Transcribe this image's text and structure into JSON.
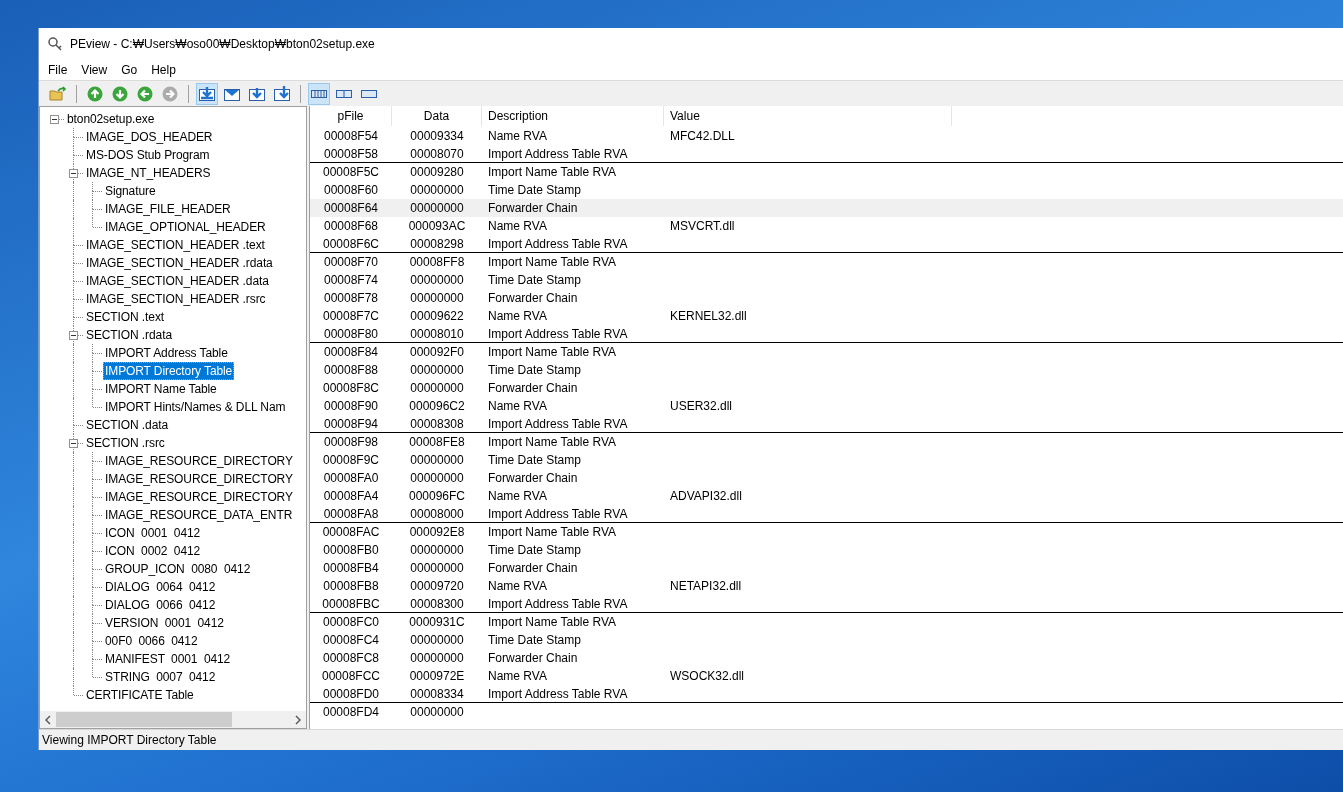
{
  "window": {
    "title": "PEview - C:₩Users₩oso00₩Desktop₩bton02setup.exe"
  },
  "menu": [
    {
      "label": "File"
    },
    {
      "label": "View"
    },
    {
      "label": "Go"
    },
    {
      "label": "Help"
    }
  ],
  "toolbar": {
    "groups": [
      {
        "buttons": [
          {
            "kind": "open",
            "pressed": false,
            "disabled": false
          }
        ]
      },
      {
        "buttons": [
          {
            "kind": "up",
            "pressed": false,
            "disabled": false
          },
          {
            "kind": "down",
            "pressed": false,
            "disabled": false
          },
          {
            "kind": "back",
            "pressed": false,
            "disabled": false
          },
          {
            "kind": "forward",
            "pressed": false,
            "disabled": true
          }
        ]
      },
      {
        "buttons": [
          {
            "kind": "view-hex",
            "pressed": true,
            "disabled": false
          },
          {
            "kind": "view-box",
            "pressed": false,
            "disabled": false
          },
          {
            "kind": "view-down",
            "pressed": false,
            "disabled": false
          },
          {
            "kind": "view-deep",
            "pressed": false,
            "disabled": false
          }
        ]
      },
      {
        "buttons": [
          {
            "kind": "layout-wide",
            "pressed": true,
            "disabled": false
          },
          {
            "kind": "layout-split",
            "pressed": false,
            "disabled": false
          },
          {
            "kind": "layout-single",
            "pressed": false,
            "disabled": false
          }
        ]
      }
    ]
  },
  "tree": [
    {
      "label": "bton02setup.exe",
      "selected": false,
      "expanded": true,
      "children": [
        {
          "label": "IMAGE_DOS_HEADER",
          "selected": false
        },
        {
          "label": "MS-DOS Stub Program",
          "selected": false
        },
        {
          "label": "IMAGE_NT_HEADERS",
          "selected": false,
          "expanded": true,
          "children": [
            {
              "label": "Signature",
              "selected": false
            },
            {
              "label": "IMAGE_FILE_HEADER",
              "selected": false
            },
            {
              "label": "IMAGE_OPTIONAL_HEADER",
              "selected": false
            }
          ]
        },
        {
          "label": "IMAGE_SECTION_HEADER .text",
          "selected": false
        },
        {
          "label": "IMAGE_SECTION_HEADER .rdata",
          "selected": false
        },
        {
          "label": "IMAGE_SECTION_HEADER .data",
          "selected": false
        },
        {
          "label": "IMAGE_SECTION_HEADER .rsrc",
          "selected": false
        },
        {
          "label": "SECTION .text",
          "selected": false
        },
        {
          "label": "SECTION .rdata",
          "selected": false,
          "expanded": true,
          "children": [
            {
              "label": "IMPORT Address Table",
              "selected": false
            },
            {
              "label": "IMPORT Directory Table",
              "selected": true
            },
            {
              "label": "IMPORT Name Table",
              "selected": false
            },
            {
              "label": "IMPORT Hints/Names & DLL Nam",
              "selected": false
            }
          ]
        },
        {
          "label": "SECTION .data",
          "selected": false
        },
        {
          "label": "SECTION .rsrc",
          "selected": false,
          "expanded": true,
          "children": [
            {
              "label": "IMAGE_RESOURCE_DIRECTORY",
              "selected": false
            },
            {
              "label": "IMAGE_RESOURCE_DIRECTORY",
              "selected": false
            },
            {
              "label": "IMAGE_RESOURCE_DIRECTORY",
              "selected": false
            },
            {
              "label": "IMAGE_RESOURCE_DATA_ENTR",
              "selected": false
            },
            {
              "label": "ICON  0001  0412",
              "selected": false
            },
            {
              "label": "ICON  0002  0412",
              "selected": false
            },
            {
              "label": "GROUP_ICON  0080  0412",
              "selected": false
            },
            {
              "label": "DIALOG  0064  0412",
              "selected": false
            },
            {
              "label": "DIALOG  0066  0412",
              "selected": false
            },
            {
              "label": "VERSION  0001  0412",
              "selected": false
            },
            {
              "label": "00F0  0066  0412",
              "selected": false
            },
            {
              "label": "MANIFEST  0001  0412",
              "selected": false
            },
            {
              "label": "STRING  0007  0412",
              "selected": false
            }
          ]
        },
        {
          "label": "CERTIFICATE Table",
          "selected": false
        }
      ]
    }
  ],
  "table": {
    "columns": [
      "pFile",
      "Data",
      "Description",
      "Value"
    ],
    "rows": [
      {
        "pfile": "00008F54",
        "data": "00009334",
        "description": "Name RVA",
        "value": "MFC42.DLL",
        "selected": false,
        "divider_below": false
      },
      {
        "pfile": "00008F58",
        "data": "00008070",
        "description": "Import Address Table RVA",
        "selected": false,
        "divider_below": true
      },
      {
        "pfile": "00008F5C",
        "data": "00009280",
        "description": "Import Name Table RVA",
        "selected": false,
        "divider_below": false
      },
      {
        "pfile": "00008F60",
        "data": "00000000",
        "description": "Time Date Stamp",
        "selected": false,
        "divider_below": false
      },
      {
        "pfile": "00008F64",
        "data": "00000000",
        "description": "Forwarder Chain",
        "selected": true,
        "divider_below": false
      },
      {
        "pfile": "00008F68",
        "data": "000093AC",
        "description": "Name RVA",
        "value": "MSVCRT.dll",
        "selected": false,
        "divider_below": false
      },
      {
        "pfile": "00008F6C",
        "data": "00008298",
        "description": "Import Address Table RVA",
        "selected": false,
        "divider_below": true
      },
      {
        "pfile": "00008F70",
        "data": "00008FF8",
        "description": "Import Name Table RVA",
        "selected": false,
        "divider_below": false
      },
      {
        "pfile": "00008F74",
        "data": "00000000",
        "description": "Time Date Stamp",
        "selected": false,
        "divider_below": false
      },
      {
        "pfile": "00008F78",
        "data": "00000000",
        "description": "Forwarder Chain",
        "selected": false,
        "divider_below": false
      },
      {
        "pfile": "00008F7C",
        "data": "00009622",
        "description": "Name RVA",
        "value": "KERNEL32.dll",
        "selected": false,
        "divider_below": false
      },
      {
        "pfile": "00008F80",
        "data": "00008010",
        "description": "Import Address Table RVA",
        "selected": false,
        "divider_below": true
      },
      {
        "pfile": "00008F84",
        "data": "000092F0",
        "description": "Import Name Table RVA",
        "selected": false,
        "divider_below": false
      },
      {
        "pfile": "00008F88",
        "data": "00000000",
        "description": "Time Date Stamp",
        "selected": false,
        "divider_below": false
      },
      {
        "pfile": "00008F8C",
        "data": "00000000",
        "description": "Forwarder Chain",
        "selected": false,
        "divider_below": false
      },
      {
        "pfile": "00008F90",
        "data": "000096C2",
        "description": "Name RVA",
        "value": "USER32.dll",
        "selected": false,
        "divider_below": false
      },
      {
        "pfile": "00008F94",
        "data": "00008308",
        "description": "Import Address Table RVA",
        "selected": false,
        "divider_below": true
      },
      {
        "pfile": "00008F98",
        "data": "00008FE8",
        "description": "Import Name Table RVA",
        "selected": false,
        "divider_below": false
      },
      {
        "pfile": "00008F9C",
        "data": "00000000",
        "description": "Time Date Stamp",
        "selected": false,
        "divider_below": false
      },
      {
        "pfile": "00008FA0",
        "data": "00000000",
        "description": "Forwarder Chain",
        "selected": false,
        "divider_below": false
      },
      {
        "pfile": "00008FA4",
        "data": "000096FC",
        "description": "Name RVA",
        "value": "ADVAPI32.dll",
        "selected": false,
        "divider_below": false
      },
      {
        "pfile": "00008FA8",
        "data": "00008000",
        "description": "Import Address Table RVA",
        "selected": false,
        "divider_below": true
      },
      {
        "pfile": "00008FAC",
        "data": "000092E8",
        "description": "Import Name Table RVA",
        "selected": false,
        "divider_below": false
      },
      {
        "pfile": "00008FB0",
        "data": "00000000",
        "description": "Time Date Stamp",
        "selected": false,
        "divider_below": false
      },
      {
        "pfile": "00008FB4",
        "data": "00000000",
        "description": "Forwarder Chain",
        "selected": false,
        "divider_below": false
      },
      {
        "pfile": "00008FB8",
        "data": "00009720",
        "description": "Name RVA",
        "value": "NETAPI32.dll",
        "selected": false,
        "divider_below": false
      },
      {
        "pfile": "00008FBC",
        "data": "00008300",
        "description": "Import Address Table RVA",
        "selected": false,
        "divider_below": true
      },
      {
        "pfile": "00008FC0",
        "data": "0000931C",
        "description": "Import Name Table RVA",
        "selected": false,
        "divider_below": false
      },
      {
        "pfile": "00008FC4",
        "data": "00000000",
        "description": "Time Date Stamp",
        "selected": false,
        "divider_below": false
      },
      {
        "pfile": "00008FC8",
        "data": "00000000",
        "description": "Forwarder Chain",
        "selected": false,
        "divider_below": false
      },
      {
        "pfile": "00008FCC",
        "data": "0000972E",
        "description": "Name RVA",
        "value": "WSOCK32.dll",
        "selected": false,
        "divider_below": false
      },
      {
        "pfile": "00008FD0",
        "data": "00008334",
        "description": "Import Address Table RVA",
        "selected": false,
        "divider_below": true
      },
      {
        "pfile": "00008FD4",
        "data": "00000000",
        "selected": false,
        "divider_below": false
      }
    ]
  },
  "status_bar": "Viewing IMPORT Directory Table"
}
